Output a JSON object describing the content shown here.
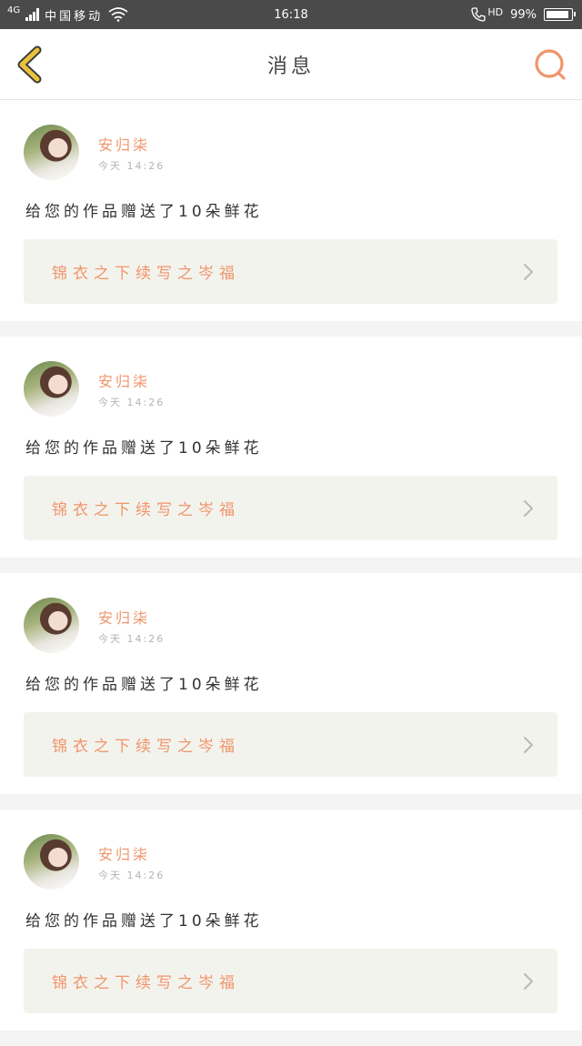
{
  "status_bar": {
    "network_type": "4G",
    "carrier": "中国移动",
    "time": "16:18",
    "call_label": "HD",
    "battery": "99%"
  },
  "nav": {
    "title": "消息",
    "back_icon": "chevron-left-icon",
    "search_icon": "search-icon"
  },
  "colors": {
    "accent": "#f0956a",
    "back_icon": "#e8c23c",
    "status_bar_bg": "#4a4a4a",
    "card_link_bg": "#f3f3ee"
  },
  "messages": [
    {
      "username": "安归柒",
      "time": "今天 14:26",
      "text": "给您的作品赠送了10朵鲜花",
      "work_title": "锦衣之下续写之岑福"
    },
    {
      "username": "安归柒",
      "time": "今天 14:26",
      "text": "给您的作品赠送了10朵鲜花",
      "work_title": "锦衣之下续写之岑福"
    },
    {
      "username": "安归柒",
      "time": "今天 14:26",
      "text": "给您的作品赠送了10朵鲜花",
      "work_title": "锦衣之下续写之岑福"
    },
    {
      "username": "安归柒",
      "time": "今天 14:26",
      "text": "给您的作品赠送了10朵鲜花",
      "work_title": "锦衣之下续写之岑福"
    }
  ]
}
